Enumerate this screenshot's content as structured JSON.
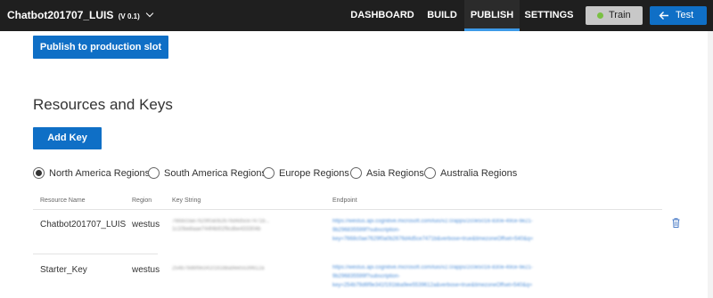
{
  "app": {
    "title": "Chatbot201707_LUIS",
    "version": "(V 0.1)"
  },
  "nav": {
    "tabs": [
      {
        "label": "DASHBOARD",
        "active": false
      },
      {
        "label": "BUILD",
        "active": false
      },
      {
        "label": "PUBLISH",
        "active": true
      },
      {
        "label": "SETTINGS",
        "active": false
      }
    ],
    "train_label": "Train",
    "test_label": "Test",
    "train_status_color": "#7ac043",
    "accent_color": "#0f6fc6"
  },
  "publish": {
    "button_label": "Publish to production slot"
  },
  "resources": {
    "title": "Resources and Keys",
    "add_key_label": "Add Key",
    "regions": [
      {
        "label": "North America Regions",
        "checked": true
      },
      {
        "label": "South America Regions",
        "checked": false
      },
      {
        "label": "Europe Regions",
        "checked": false
      },
      {
        "label": "Asia Regions",
        "checked": false
      },
      {
        "label": "Australia Regions",
        "checked": false
      }
    ],
    "columns": [
      "Resource Name",
      "Region",
      "Key String",
      "Endpoint"
    ],
    "rows": [
      {
        "name": "Chatbot201707_LUIS",
        "region": "westus",
        "key_lines": [
          "7668c0ae7629f0a0b2676d4d5ce7471b...",
          "1c10be8aae744f4b91f9cdbe433304b"
        ],
        "endpoint_lines": [
          "https://westus.api.cognitive.microsoft.com/luis/v2.0/apps/2c0e5016-830e-49ce-9e21-",
          "9b296835599f?subscription-",
          "key=7668c0ae7629f0a0b2676d4d5ce7471b&verbose=true&timezoneOffset=540&q="
        ]
      },
      {
        "name": "Starter_Key",
        "region": "westus",
        "key_lines": [
          "254b79d6f9e341f191bba9ee5539612a"
        ],
        "endpoint_lines": [
          "https://westus.api.cognitive.microsoft.com/luis/v2.0/apps/2c0e5016-830e-49ce-9e21-",
          "9b296835599f?subscription-",
          "key=254b79d6f9e341f191bba9ee5539612a&verbose=true&timezoneOffset=540&q="
        ]
      }
    ],
    "delete_icon": "trash-icon"
  }
}
